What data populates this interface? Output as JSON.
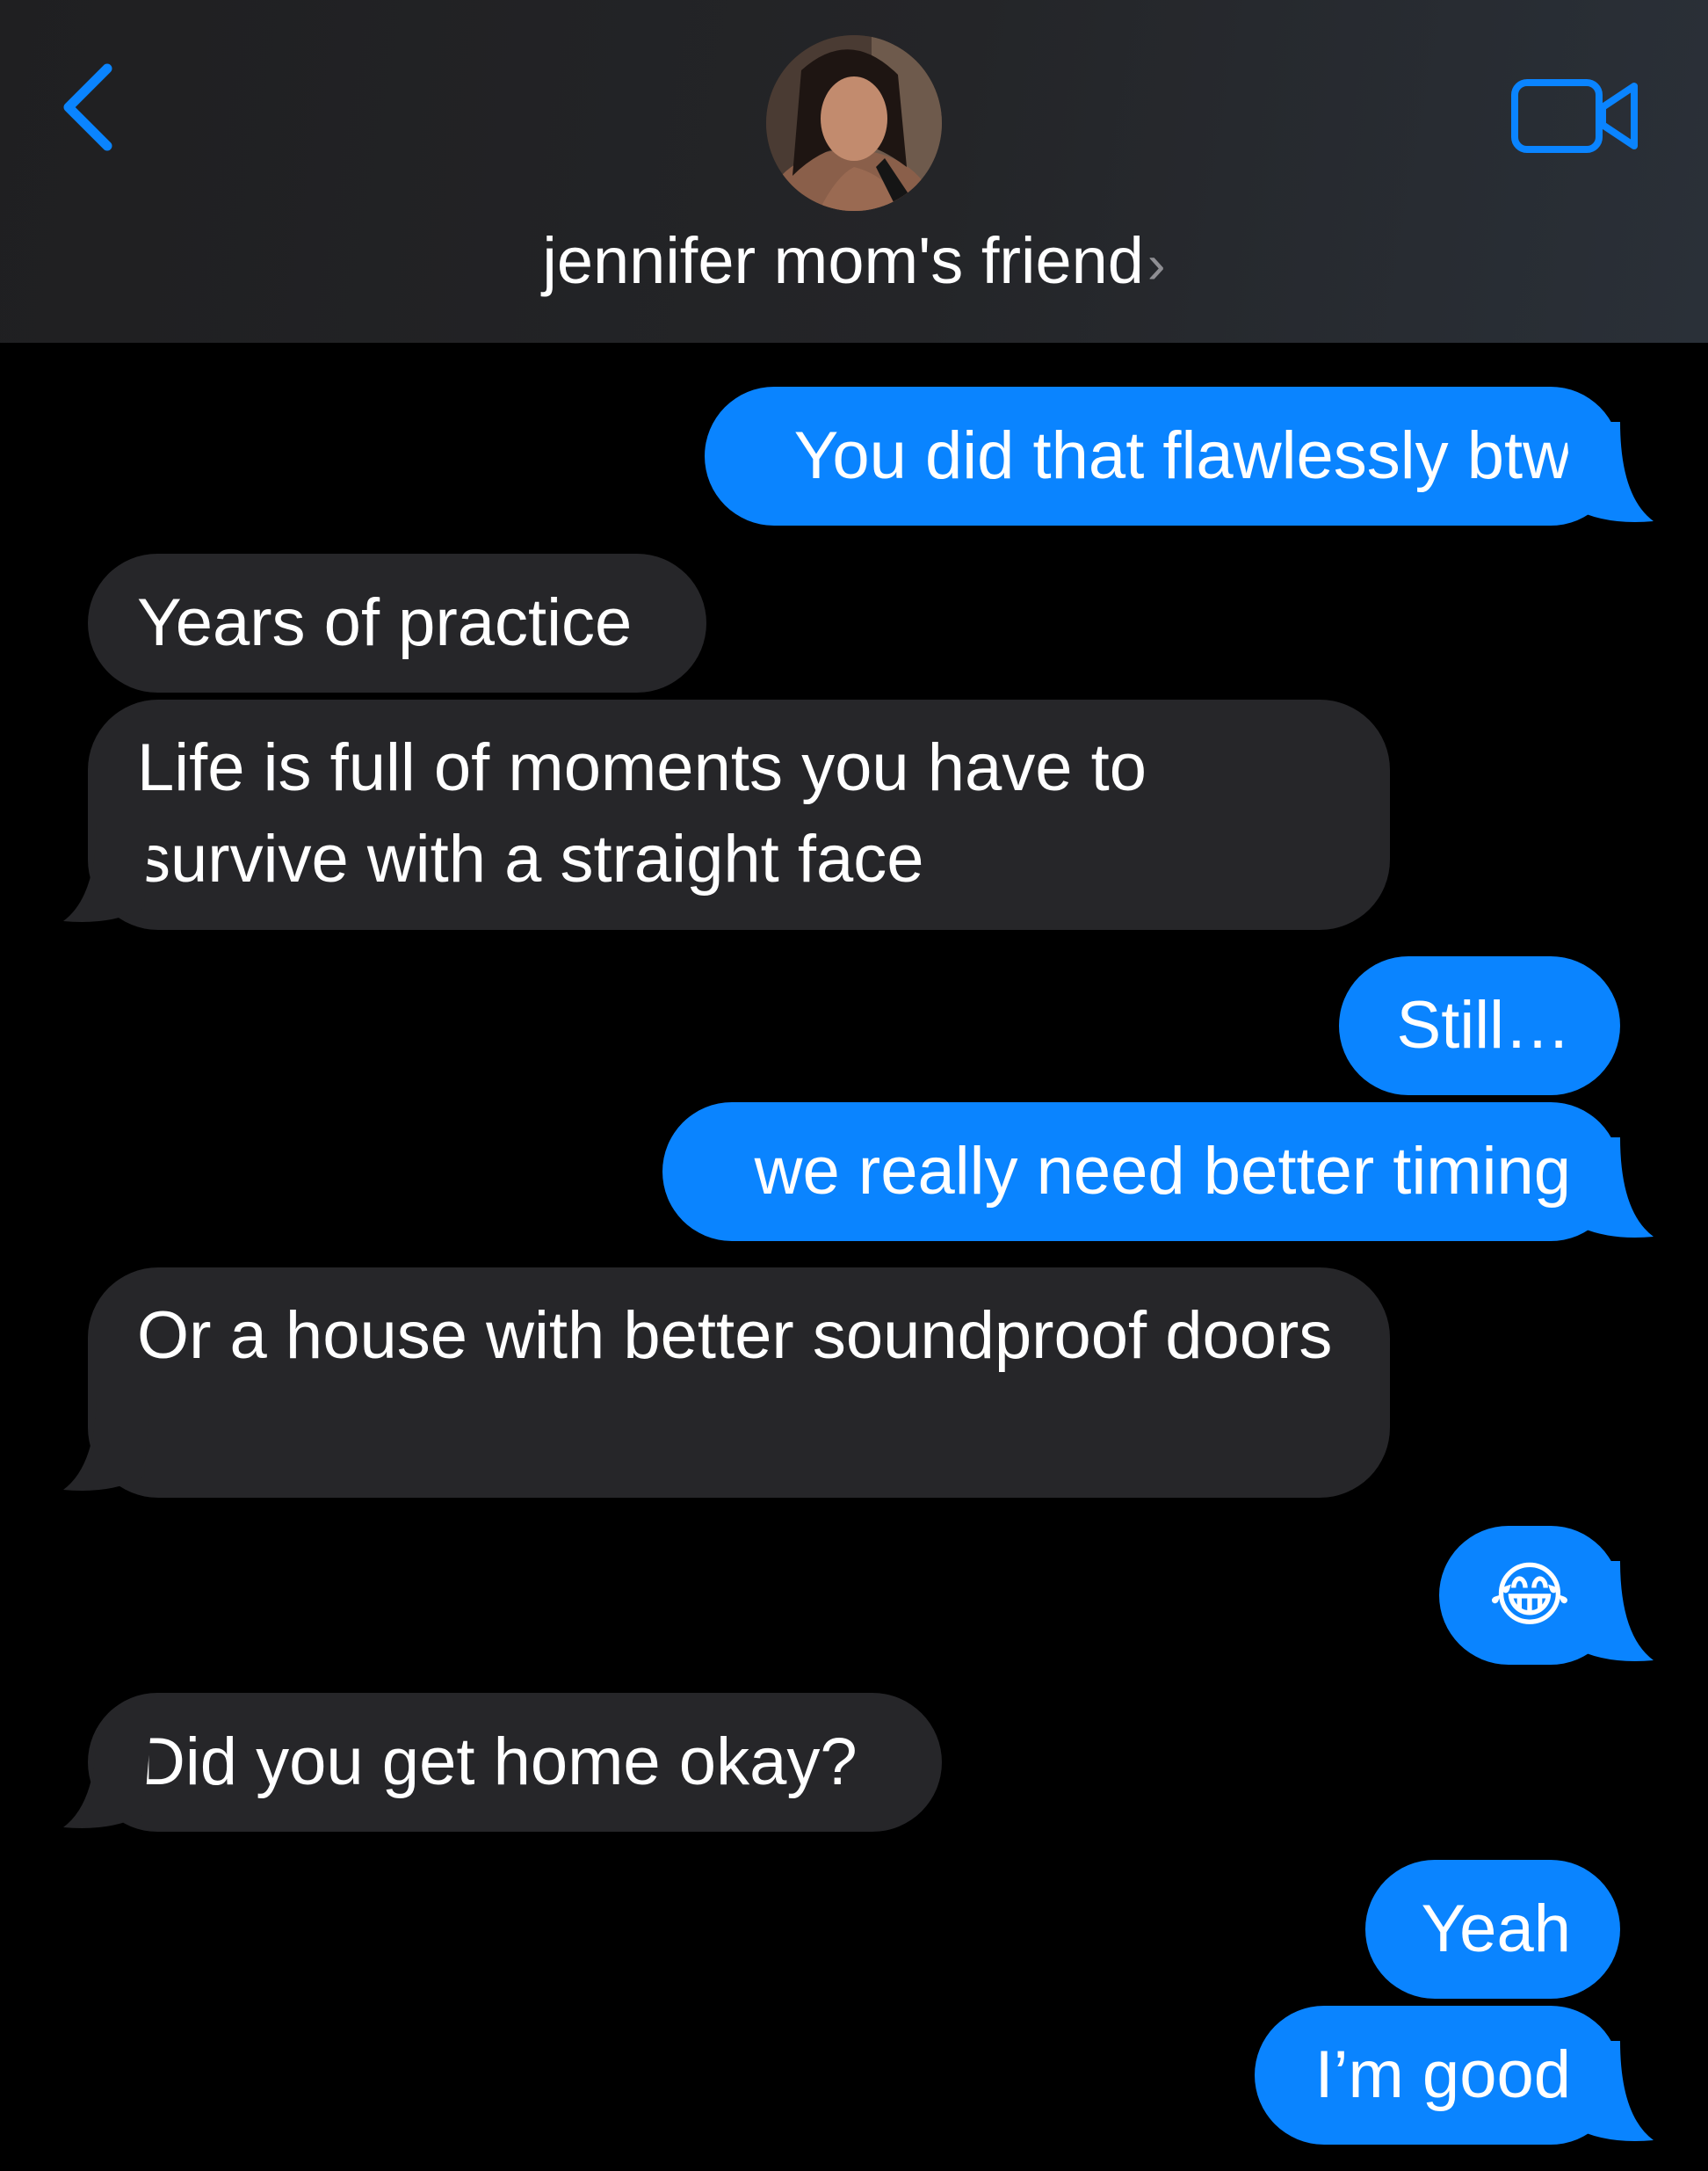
{
  "header": {
    "contact_name": "jennifer mom's friend",
    "chevron": "›",
    "back_icon": "chevron-left-icon",
    "video_icon": "video-camera-icon"
  },
  "colors": {
    "accent": "#0a84ff",
    "incoming_bubble": "#262629",
    "background": "#000000"
  },
  "messages": [
    {
      "from": "me",
      "text": "You did that flawlessly btw"
    },
    {
      "from": "them",
      "text": "Years of practice"
    },
    {
      "from": "them",
      "text": "Life is full of moments you have to survive with a straight face"
    },
    {
      "from": "me",
      "text": "Still…"
    },
    {
      "from": "me",
      "text": "we really need better timing"
    },
    {
      "from": "them",
      "text": "Or a house with better soundproof doors"
    },
    {
      "from": "me",
      "text": "😂"
    },
    {
      "from": "them",
      "text": "Did you get home okay?"
    },
    {
      "from": "me",
      "text": "Yeah"
    },
    {
      "from": "me",
      "text": "I’m good"
    }
  ]
}
